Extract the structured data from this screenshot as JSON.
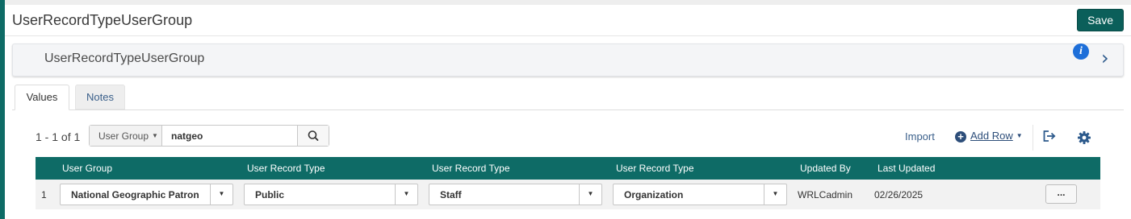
{
  "header": {
    "title": "UserRecordTypeUserGroup",
    "save_label": "Save"
  },
  "panel": {
    "title": "UserRecordTypeUserGroup"
  },
  "tabs": [
    {
      "label": "Values",
      "active": true
    },
    {
      "label": "Notes",
      "active": false
    }
  ],
  "toolbar": {
    "count": "1 - 1 of 1",
    "search_filter": "User Group",
    "search_value": "natgeo",
    "import_label": "Import",
    "add_row_label": "Add Row"
  },
  "table": {
    "columns": [
      "User Group",
      "User Record Type",
      "User Record Type",
      "User Record Type",
      "Updated By",
      "Last Updated"
    ],
    "rows": [
      {
        "num": "1",
        "user_group": "National Geographic Patron",
        "type1": "Public",
        "type2": "Staff",
        "type3": "Organization",
        "updated_by": "WRLCadmin",
        "last_updated": "02/26/2025",
        "more_label": "..."
      }
    ]
  },
  "icons": {
    "info": "info-icon",
    "chevron": "chevron-right-icon",
    "search": "search-icon",
    "add": "plus-circle-icon",
    "export": "export-icon",
    "settings": "gear-icon"
  },
  "colors": {
    "brand": "#0e6b66",
    "save_button": "#0b5f5a",
    "link": "#3a5f8a",
    "info": "#1e6fd9"
  }
}
